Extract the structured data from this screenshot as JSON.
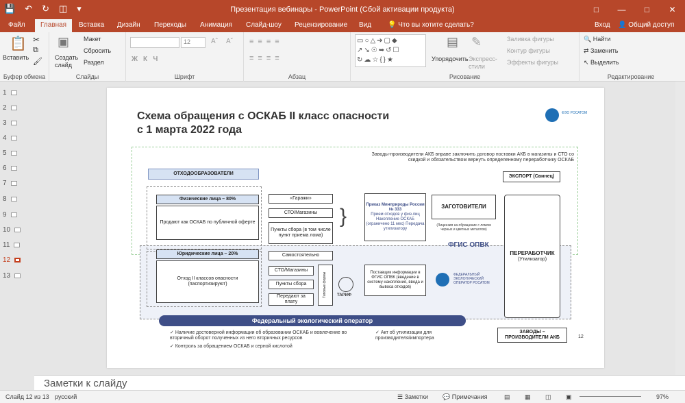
{
  "window": {
    "title": "Презентация вебинары - PowerPoint (Сбой активации продукта)",
    "login": "Вход"
  },
  "tabs": [
    "Файл",
    "Главная",
    "Вставка",
    "Дизайн",
    "Переходы",
    "Анимация",
    "Слайд-шоу",
    "Рецензирование",
    "Вид"
  ],
  "tell_me": "Что вы хотите сделать?",
  "share": "Общий доступ",
  "ribbon": {
    "paste": "Вставить",
    "create_slide": "Создать слайд",
    "layout": "Макет",
    "reset": "Сбросить",
    "section": "Раздел",
    "font_size": "12",
    "arrange": "Упорядочить",
    "express_styles": "Экспресс-стили",
    "shape_fill": "Заливка фигуры",
    "shape_outline": "Контур фигуры",
    "shape_effects": "Эффекты фигуры",
    "find": "Найти",
    "replace": "Заменить",
    "select": "Выделить",
    "groups": {
      "clipboard": "Буфер обмена",
      "slides": "Слайды",
      "font": "Шрифт",
      "paragraph": "Абзац",
      "drawing": "Рисование",
      "editing": "Редактирование"
    }
  },
  "thumbnails": [
    "1",
    "2",
    "3",
    "4",
    "5",
    "6",
    "7",
    "8",
    "9",
    "10",
    "11",
    "12",
    "13"
  ],
  "selected_slide": "12",
  "slide": {
    "title_line1": "Схема обращения с ОСКАБ II класс опасности",
    "title_line2": "с 1 марта 2022 года",
    "logo_text": "ФЭО РОСАТОМ",
    "top_note": "Заводы-производители АКБ вправе заключить договор поставки АКБ в магазины и СТО со скидкой и обязательством вернуть определенному переработчику ОСКАБ",
    "generators": "ОТХОДООБРАЗОВАТЕЛИ",
    "individuals": "Физические лица – 80%",
    "individuals_desc": "Продают как ОСКАБ по публичной оферте",
    "garages": "«Гаражи»",
    "sto_shops": "СТО/Магазины",
    "collection_points": "Пункты сбора (в том числе пункт приема лома)",
    "order": "Приказ Минприроды России № 333",
    "order_items": "Прием отходов у физ.лиц Накопление ОСКАБ (ограничено 11 мес) Передача утилизатору",
    "collectors": "ЗАГОТОВИТЕЛИ",
    "collectors_note": "(Лицензия на обращение с ломом черных и цветных металлов)",
    "export": "ЭКСПОРТ (Свинец)",
    "processor": "ПЕРЕРАБОТЧИК",
    "processor_sub": "(Утилизатор)",
    "fgis": "ФГИС ОПВК",
    "legal": "Юридические лица – 20%",
    "legal_desc": "Отход II классов опасности",
    "legal_desc2": "(паспортизируют)",
    "self_transport": "Самостоятельно",
    "sto2": "СТО/Магазины",
    "collection2": "Пункты сбора",
    "paid": "Передают за плату",
    "typical_forms": "Типовые формы",
    "tariff": "ТАРИФ",
    "fgis_info": "Поставщик информации в ФГИС ОПВК (введение в систему накопления, ввода и вывоса отходов)",
    "fed_operator_small": "ФЕДЕРАЛЬНЫЙ ЭКОЛОГИЧЕСКИЙ ОПЕРАТОР РОСАТОМ",
    "fed_operator": "Федеральный экологический оператор",
    "plants": "ЗАВОДЫ – ПРОИЗВОДИТЕЛИ АКБ",
    "page_num": "12",
    "bullets": [
      "Наличие достоверной информации об образовании ОСКАБ и вовлечение во вторичный оборот полученных из него вторичных ресурсов",
      "Контроль за  обращением ОСКАБ и серной кислотой",
      "Акт об утилизации для производителя/импортера"
    ]
  },
  "notes_placeholder": "Заметки к слайду",
  "status": {
    "slide_info": "Слайд 12 из 13",
    "language": "русский",
    "notes": "Заметки",
    "comments": "Примечания",
    "zoom": "97%"
  },
  "colors": {
    "accent": "#b7472a",
    "slide_blue": "#3e4e87",
    "label_fill": "#d6e2f3"
  }
}
